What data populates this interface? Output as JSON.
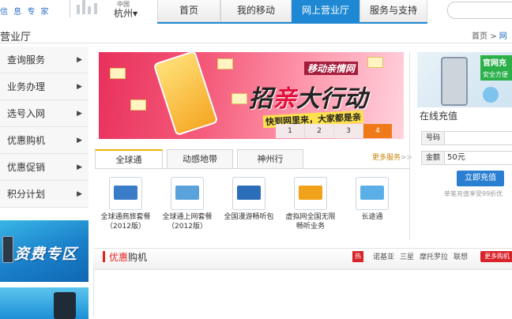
{
  "header": {
    "logo_text": "信 息 专 家",
    "city_small": "中国",
    "city": "杭州",
    "nav_tabs": [
      {
        "label": "首页",
        "active": false
      },
      {
        "label": "我的移动",
        "active": false
      },
      {
        "label": "网上营业厅",
        "active": true
      },
      {
        "label": "服务与支持",
        "active": false
      }
    ]
  },
  "breadcrumb_row": {
    "title": "营业厅",
    "crumb_home": "首页",
    "crumb_sep": ">",
    "crumb_current": "网"
  },
  "sidebar": {
    "items": [
      {
        "label": "查询服务"
      },
      {
        "label": "业务办理"
      },
      {
        "label": "选号入网"
      },
      {
        "label": "优惠购机"
      },
      {
        "label": "优惠促销"
      },
      {
        "label": "积分计划"
      }
    ],
    "banner_text": "资费专区"
  },
  "hero": {
    "subtitle": "移动亲情网",
    "title_a": "招",
    "title_b": "亲",
    "title_c": "大行动",
    "tag": "快到网里来，大家都是亲",
    "pages": [
      "1",
      "2",
      "3",
      "4"
    ],
    "active_page": "4"
  },
  "services": {
    "tabs": [
      {
        "label": "全球通",
        "active": true
      },
      {
        "label": "动感地带",
        "active": false
      },
      {
        "label": "神州行",
        "active": false
      }
    ],
    "more": "更多服务",
    "items": [
      {
        "line1": "全球通商旅套餐",
        "line2": "（2012版）",
        "icon": "globe-plan-icon",
        "color": "#3a7cc8"
      },
      {
        "line1": "全球通上网套餐",
        "line2": "（2012版）",
        "icon": "globe-net-icon",
        "color": "#5aa2dc"
      },
      {
        "line1": "全国漫游畅听包",
        "line2": "",
        "icon": "roaming-icon",
        "color": "#2b6db8"
      },
      {
        "line1": "虚拟网全国无限",
        "line2": "畅听业务",
        "icon": "virtual-net-icon",
        "color": "#f0a21b"
      },
      {
        "line1": "长途通",
        "line2": "",
        "icon": "long-distance-icon",
        "color": "#5ab0e6"
      }
    ]
  },
  "recharge": {
    "banner_tag1": "官网充值",
    "banner_tag2": "安全方便",
    "title": "在线充值",
    "number_label": "号码",
    "number_value": "",
    "amount_label": "金额",
    "amount_value": "50元",
    "button": "立即充值",
    "note": "单笔充值享受99折优"
  },
  "promo": {
    "title_a": "优惠",
    "title_b": "购机",
    "hot": "热",
    "brands": [
      "诺基亚",
      "三星",
      "摩托罗拉",
      "联想"
    ],
    "more": "更多购机"
  },
  "colors": {
    "nav_active": "#1e88d4",
    "accent_red": "#e2201c",
    "hero_pink": "#e8305c",
    "pager_active": "#f07a1a"
  }
}
